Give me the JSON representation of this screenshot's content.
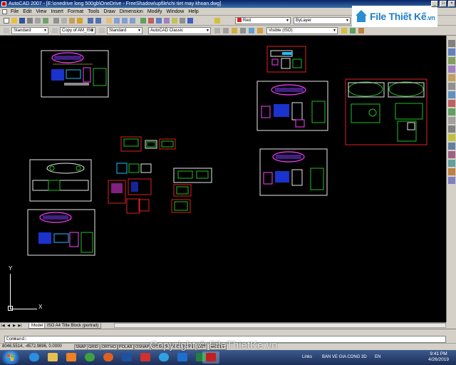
{
  "window": {
    "title": "AutoCAD 2007 - [E:\\onedrive long 500gb\\OneDrive - FreeShadow\\upfile\\chi tiet may khoan.dwg]"
  },
  "menu": [
    "File",
    "Edit",
    "View",
    "Insert",
    "Format",
    "Tools",
    "Draw",
    "Dimension",
    "Modify",
    "Window",
    "Help"
  ],
  "logo": {
    "text": "File Thiết Kế",
    "suffix": ".vn"
  },
  "toolbar1": {
    "color_combo": "Red",
    "linetype_combo": "ByLayer"
  },
  "toolbar2": {
    "text_style": "Standard",
    "dim_style": "Copy of AM_ISC",
    "table_style": "Standard",
    "workspace": "AutoCAD Classic",
    "visibility": "Visible (ISO)"
  },
  "canvas": {
    "ucs_y": "Y",
    "ucs_x": "X"
  },
  "tabs": {
    "model": "Model",
    "layout1": "ISO A4 Title Block (portrait)"
  },
  "command": {
    "prompt": "Command:"
  },
  "status": {
    "coords": "8046.5514, -4572.9896, 0.0000",
    "buttons": [
      "SNAP",
      "GRID",
      "ORTHO",
      "POLAR",
      "OSNAP",
      "OTRACK",
      "DUCS",
      "DYN",
      "LWT",
      "MODEL"
    ]
  },
  "taskbar": {
    "tray_links": "Links",
    "tray_text": "BAN VE GIA CONG 3D",
    "lang": "EN",
    "time": "9:41 PM",
    "date": "4/26/2019"
  },
  "watermark": "Copyright © FileThietKe.vn",
  "colors": {
    "canvas_bg": "#000000",
    "accent_red": "#e02020",
    "accent_green": "#20c020",
    "accent_magenta": "#ff40ff"
  }
}
